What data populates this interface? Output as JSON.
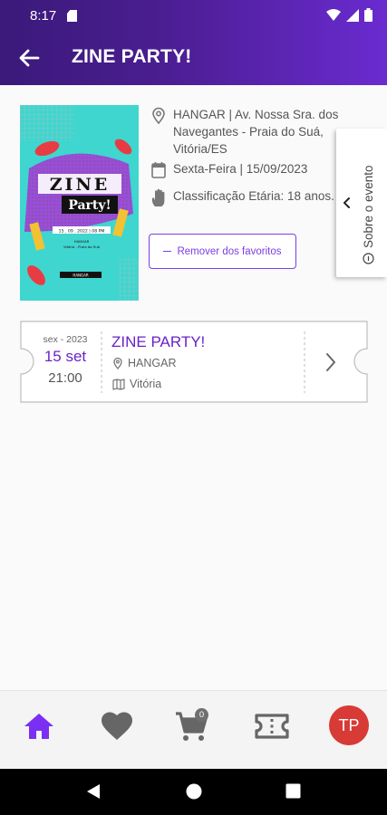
{
  "status_bar": {
    "time": "8:17"
  },
  "app_bar": {
    "title": "ZINE PARTY!"
  },
  "event": {
    "location": "HANGAR | Av. Nossa Sra. dos Navegantes - Praia do Suá, Vitória/ES",
    "date": "Sexta-Feira | 15/09/2023",
    "rating": "Classificação Etária: 18 anos.",
    "favorite_button": "Remover dos favoritos"
  },
  "poster": {
    "title_line1": "ZINE",
    "title_line2": "Party!",
    "date_line": "15 . 09 . 2022 | 08 PM",
    "info_line1": "HANGAR",
    "info_line2": "Vitória - Praia do Suá",
    "footer": "HANGAR"
  },
  "side_tab": {
    "label": "Sobre o evento"
  },
  "ticket": {
    "weekday_year": "sex - 2023",
    "day_month": "15 set",
    "time": "21:00",
    "title": "ZINE PARTY!",
    "venue": "HANGAR",
    "city": "Vitória"
  },
  "bottom_nav": {
    "cart_count": "0",
    "avatar_initials": "TP",
    "active_color": "#7b2ff2",
    "inactive_color": "#666666"
  }
}
